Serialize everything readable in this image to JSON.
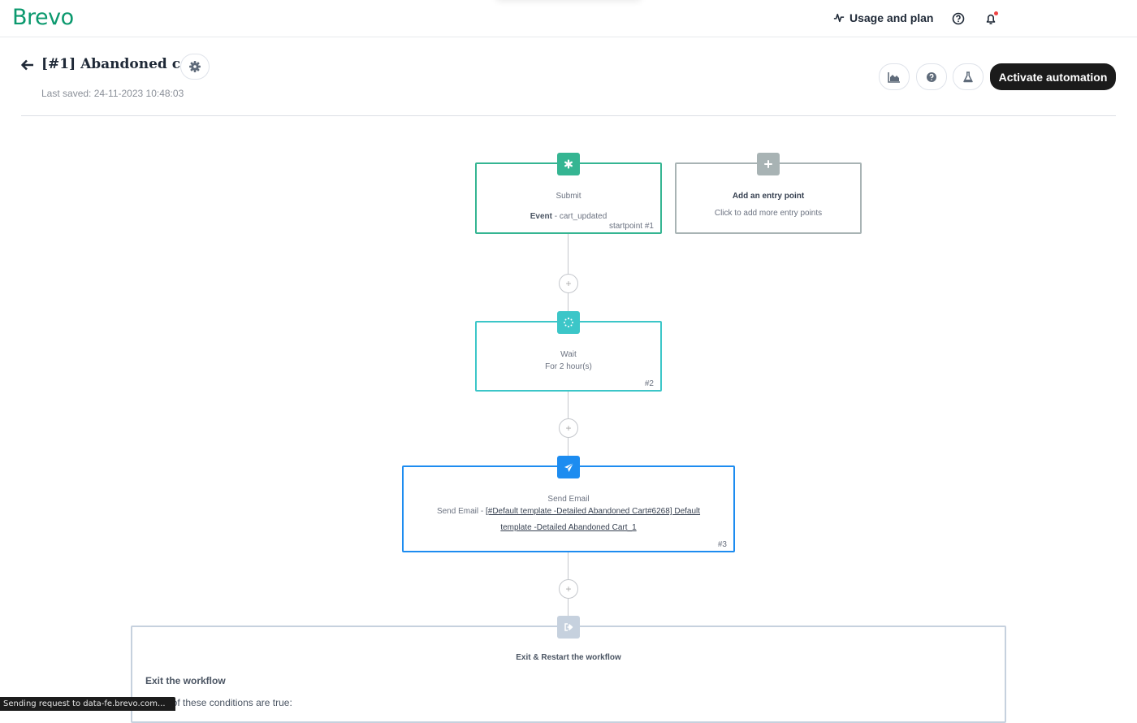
{
  "topbar": {
    "logo": "Brevo",
    "usage_label": "Usage and plan",
    "icons": [
      "activity-icon",
      "help-icon",
      "bell-icon"
    ],
    "notification_dot_color": "#ef4444"
  },
  "header": {
    "title": "[#1] Abandoned cart",
    "last_saved": "Last saved: 24-11-2023 10:48:03",
    "activate_label": "Activate automation",
    "toolbar_icons": [
      "stats-icon",
      "help-icon",
      "flask-icon"
    ]
  },
  "workflow": {
    "start": {
      "title": "Submit",
      "desc_bold": "Event",
      "desc_rest": " - cart_updated",
      "id": "startpoint #1",
      "color": "#35b592",
      "icon": "asterisk-icon"
    },
    "add_entry": {
      "title": "Add an entry point",
      "desc": "Click to add more entry points",
      "color": "#a8b3b4",
      "icon": "plus-icon"
    },
    "wait": {
      "title": "Wait",
      "desc": "For 2 hour(s)",
      "id": "#2",
      "color": "#3cc6c8",
      "icon": "spinner-icon"
    },
    "email": {
      "title": "Send Email",
      "desc_prefix": "Send Email - ",
      "template_link": "[#Default template -Detailed Abandoned Cart#6268] Default template -Detailed Abandoned Cart_1",
      "id": "#3",
      "color": "#1d8cf0",
      "icon": "paper-plane-icon"
    },
    "exit": {
      "title": "Exit & Restart the workflow",
      "section_title": "Exit the workflow",
      "condition_text": "If any of these conditions are true:",
      "color": "#c6d1de",
      "icon": "exit-icon"
    }
  },
  "status_bar": {
    "text": "Sending request to data-fe.brevo.com..."
  }
}
